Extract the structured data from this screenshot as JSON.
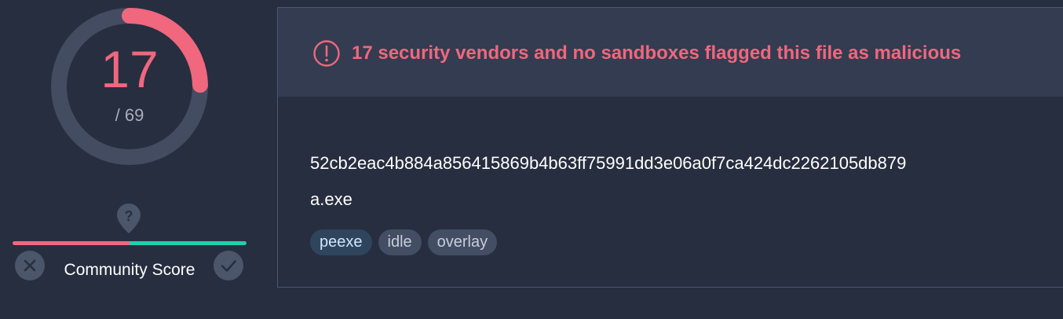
{
  "score": {
    "detections": "17",
    "total": "/ 69",
    "detection_ratio": 0.2464,
    "colors": {
      "malicious": "#f0677e",
      "ring_track": "#434c60",
      "harmless": "#1cd2ae"
    }
  },
  "community": {
    "label": "Community Score",
    "help_icon": "question-pin-icon",
    "downvote_icon": "close-icon",
    "upvote_icon": "check-icon",
    "bar_negative_fraction": 0.5
  },
  "alert": {
    "icon": "exclamation-circle-icon",
    "text": "17 security vendors and no sandboxes flagged this file as malicious",
    "color": "#f0677e"
  },
  "file": {
    "hash": "52cb2eac4b884a856415869b4b63ff75991dd3e06a0f7ca424dc2262105db879",
    "name": "a.exe",
    "tags": [
      {
        "label": "peexe"
      },
      {
        "label": "idle"
      },
      {
        "label": "overlay"
      }
    ]
  }
}
